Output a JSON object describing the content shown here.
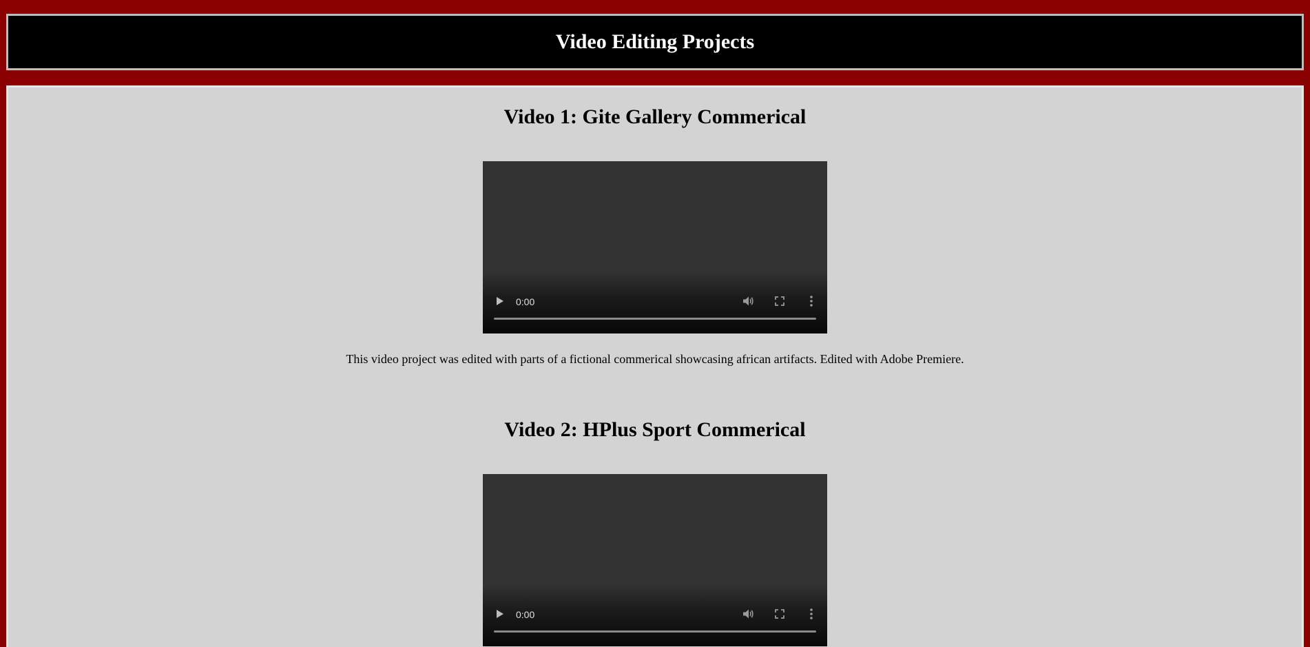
{
  "header": {
    "title": "Video Editing Projects"
  },
  "projects": [
    {
      "heading": "Video 1: Gite Gallery Commerical",
      "video": {
        "time": "0:00"
      },
      "description": "This video project was edited with parts of a fictional commerical showcasing african artifacts. Edited with Adobe Premiere."
    },
    {
      "heading": "Video 2: HPlus Sport Commerical",
      "video": {
        "time": "0:00"
      }
    }
  ],
  "colors": {
    "page_background": "#8b0000",
    "header_background": "#000000",
    "content_background": "#d3d3d3",
    "video_background": "#333333"
  },
  "icons": {
    "play": "play-icon",
    "volume": "volume-icon",
    "fullscreen": "fullscreen-icon",
    "more": "more-vertical-icon"
  }
}
